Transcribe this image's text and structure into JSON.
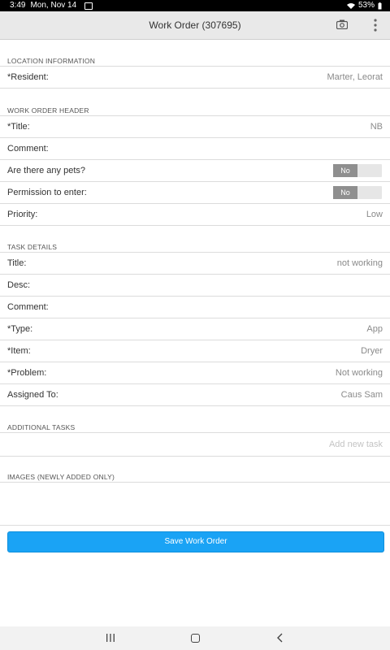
{
  "status_bar": {
    "time": "3:49",
    "date": "Mon, Nov 14",
    "battery": "53%"
  },
  "app_bar": {
    "title": "Work Order (307695)"
  },
  "sections": {
    "location": {
      "header": "LOCATION INFORMATION",
      "resident_label": "*Resident:",
      "resident_value": "Marter, Leorat"
    },
    "header": {
      "header": "WORK ORDER HEADER",
      "title_label": "*Title:",
      "title_value": "NB",
      "comment_label": "Comment:",
      "pets_label": "Are there any pets?",
      "pets_value": "No",
      "permission_label": "Permission to enter:",
      "permission_value": "No",
      "priority_label": "Priority:",
      "priority_value": "Low"
    },
    "task": {
      "header": "TASK DETAILS",
      "title_label": "Title:",
      "title_value": "not working",
      "desc_label": "Desc:",
      "comment_label": "Comment:",
      "type_label": "*Type:",
      "type_value": "App",
      "item_label": "*Item:",
      "item_value": "Dryer",
      "problem_label": "*Problem:",
      "problem_value": "Not working",
      "assigned_label": "Assigned To:",
      "assigned_value": "Caus Sam"
    },
    "additional": {
      "header": "ADDITIONAL TASKS",
      "placeholder": "Add new task"
    },
    "images": {
      "header": "IMAGES (NEWLY ADDED ONLY)"
    }
  },
  "save_button": {
    "label": "Save Work Order"
  },
  "colors": {
    "accent": "#1aa3f5",
    "toggle_off": "#8f8f8f"
  },
  "icons": [
    "camera-icon",
    "more-vert-icon",
    "wifi-icon",
    "battery-icon",
    "recent-apps-icon",
    "home-icon",
    "back-icon"
  ]
}
